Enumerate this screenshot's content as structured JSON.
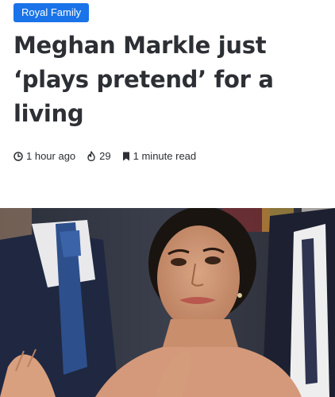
{
  "article": {
    "category": "Royal Family",
    "title": "Meghan Markle just ‘plays pretend’ for a living",
    "meta": {
      "time_ago": "1 hour ago",
      "views": "29",
      "read_time": "1 minute read"
    },
    "icons": {
      "time": "clock-icon",
      "views": "flame-icon",
      "read_time": "bookmark-icon"
    },
    "hero_image": {
      "icon": "photo"
    }
  },
  "colors": {
    "badge_background": "#1a73e8",
    "text": "#2c2f34"
  }
}
